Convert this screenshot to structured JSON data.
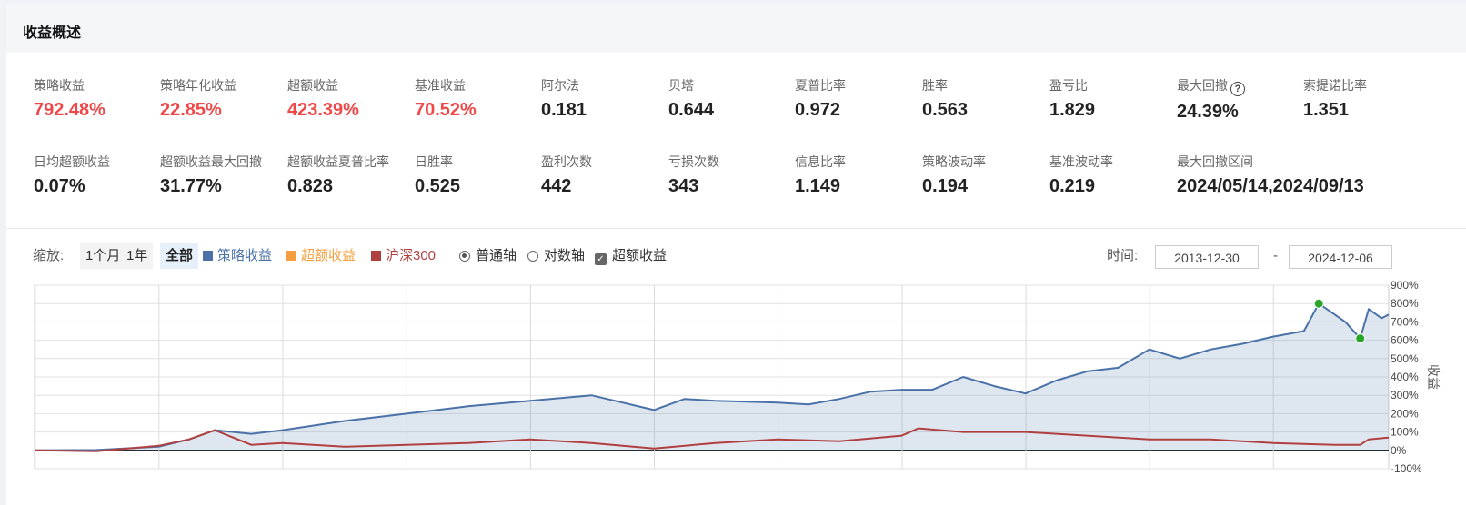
{
  "header": {
    "title": "收益概述"
  },
  "metrics_row1": [
    {
      "label": "策略收益",
      "value": "792.48%",
      "color": "#f04848"
    },
    {
      "label": "策略年化收益",
      "value": "22.85%",
      "color": "#f04848"
    },
    {
      "label": "超额收益",
      "value": "423.39%",
      "color": "#f04848"
    },
    {
      "label": "基准收益",
      "value": "70.52%",
      "color": "#f04848"
    },
    {
      "label": "阿尔法",
      "value": "0.181"
    },
    {
      "label": "贝塔",
      "value": "0.644"
    },
    {
      "label": "夏普比率",
      "value": "0.972"
    },
    {
      "label": "胜率",
      "value": "0.563"
    },
    {
      "label": "盈亏比",
      "value": "1.829"
    },
    {
      "label": "最大回撤",
      "value": "24.39%",
      "help_icon": "question-circle-icon"
    },
    {
      "label": "索提诺比率",
      "value": "1.351"
    }
  ],
  "metrics_row2": [
    {
      "label": "日均超额收益",
      "value": "0.07%"
    },
    {
      "label": "超额收益最大回撤",
      "value": "31.77%"
    },
    {
      "label": "超额收益夏普比率",
      "value": "0.828"
    },
    {
      "label": "日胜率",
      "value": "0.525"
    },
    {
      "label": "盈利次数",
      "value": "442"
    },
    {
      "label": "亏损次数",
      "value": "343"
    },
    {
      "label": "信息比率",
      "value": "1.149"
    },
    {
      "label": "策略波动率",
      "value": "0.194"
    },
    {
      "label": "基准波动率",
      "value": "0.219"
    },
    {
      "label": "最大回撤区间",
      "value": "2024/05/14,2024/09/13"
    }
  ],
  "controls": {
    "zoom_label": "缩放:",
    "zoom_options": [
      "1个月",
      "1年",
      "全部"
    ],
    "zoom_selected": "全部",
    "legend": [
      {
        "name": "策略收益",
        "color": "#4a72a8"
      },
      {
        "name": "超额收益",
        "color": "#f5a040"
      },
      {
        "name": "沪深300",
        "color": "#b04040"
      }
    ],
    "axis_options": [
      {
        "label": "普通轴",
        "selected": true
      },
      {
        "label": "对数轴",
        "selected": false
      }
    ],
    "excess_checkbox": {
      "label": "超额收益",
      "checked": true
    },
    "time_label": "时间:",
    "date_start": "2013-12-30",
    "date_sep": "-",
    "date_end": "2024-12-06"
  },
  "chart_data": {
    "type": "area",
    "ylabel": "收益",
    "ylim": [
      -100,
      900
    ],
    "yticks": [
      -100,
      0,
      100,
      200,
      300,
      400,
      500,
      600,
      700,
      800,
      900
    ],
    "ytick_labels": [
      "-100%",
      "0%",
      "100%",
      "200%",
      "300%",
      "400%",
      "500%",
      "600%",
      "700%",
      "800%",
      "900%"
    ],
    "grid": true,
    "x_start": "2013-12-30",
    "x_end": "2024-12-06",
    "series": [
      {
        "name": "策略收益",
        "color": "#4a72a8",
        "x": [
          "2013-12-30",
          "2014-06-30",
          "2014-12-31",
          "2015-03-31",
          "2015-06-15",
          "2015-09-30",
          "2015-12-31",
          "2016-06-30",
          "2016-12-31",
          "2017-06-30",
          "2017-12-31",
          "2018-06-30",
          "2018-12-31",
          "2019-03-31",
          "2019-06-30",
          "2019-12-31",
          "2020-03-31",
          "2020-06-30",
          "2020-09-30",
          "2020-12-31",
          "2021-03-31",
          "2021-06-30",
          "2021-09-30",
          "2021-12-31",
          "2022-03-31",
          "2022-06-30",
          "2022-09-30",
          "2022-12-31",
          "2023-03-31",
          "2023-06-30",
          "2023-09-30",
          "2023-12-31",
          "2024-03-31",
          "2024-05-14",
          "2024-07-31",
          "2024-09-13",
          "2024-10-08",
          "2024-11-15",
          "2024-12-06"
        ],
        "values": [
          0,
          2,
          20,
          60,
          110,
          90,
          110,
          160,
          200,
          240,
          270,
          300,
          220,
          280,
          270,
          260,
          250,
          280,
          320,
          330,
          330,
          400,
          350,
          310,
          380,
          430,
          450,
          550,
          500,
          550,
          580,
          620,
          650,
          800,
          700,
          610,
          770,
          720,
          740
        ]
      },
      {
        "name": "沪深300",
        "color": "#b04040",
        "x": [
          "2013-12-30",
          "2014-06-30",
          "2014-12-31",
          "2015-03-31",
          "2015-06-15",
          "2015-09-30",
          "2015-12-31",
          "2016-06-30",
          "2016-12-31",
          "2017-06-30",
          "2017-12-31",
          "2018-06-30",
          "2018-12-31",
          "2019-06-30",
          "2019-12-31",
          "2020-06-30",
          "2020-12-31",
          "2021-02-18",
          "2021-06-30",
          "2021-12-31",
          "2022-06-30",
          "2022-12-31",
          "2023-06-30",
          "2023-12-31",
          "2024-06-30",
          "2024-09-13",
          "2024-10-08",
          "2024-12-06"
        ],
        "values": [
          0,
          -5,
          25,
          60,
          110,
          30,
          40,
          20,
          30,
          40,
          60,
          40,
          10,
          40,
          60,
          50,
          80,
          120,
          100,
          100,
          80,
          60,
          60,
          40,
          30,
          30,
          60,
          70
        ]
      }
    ],
    "markers": [
      {
        "label": "最大回撤起点",
        "x": "2024-05-14",
        "y": 800,
        "color": "#2aa52a"
      },
      {
        "label": "最大回撤终点",
        "x": "2024-09-13",
        "y": 610,
        "color": "#2aa52a"
      }
    ]
  }
}
